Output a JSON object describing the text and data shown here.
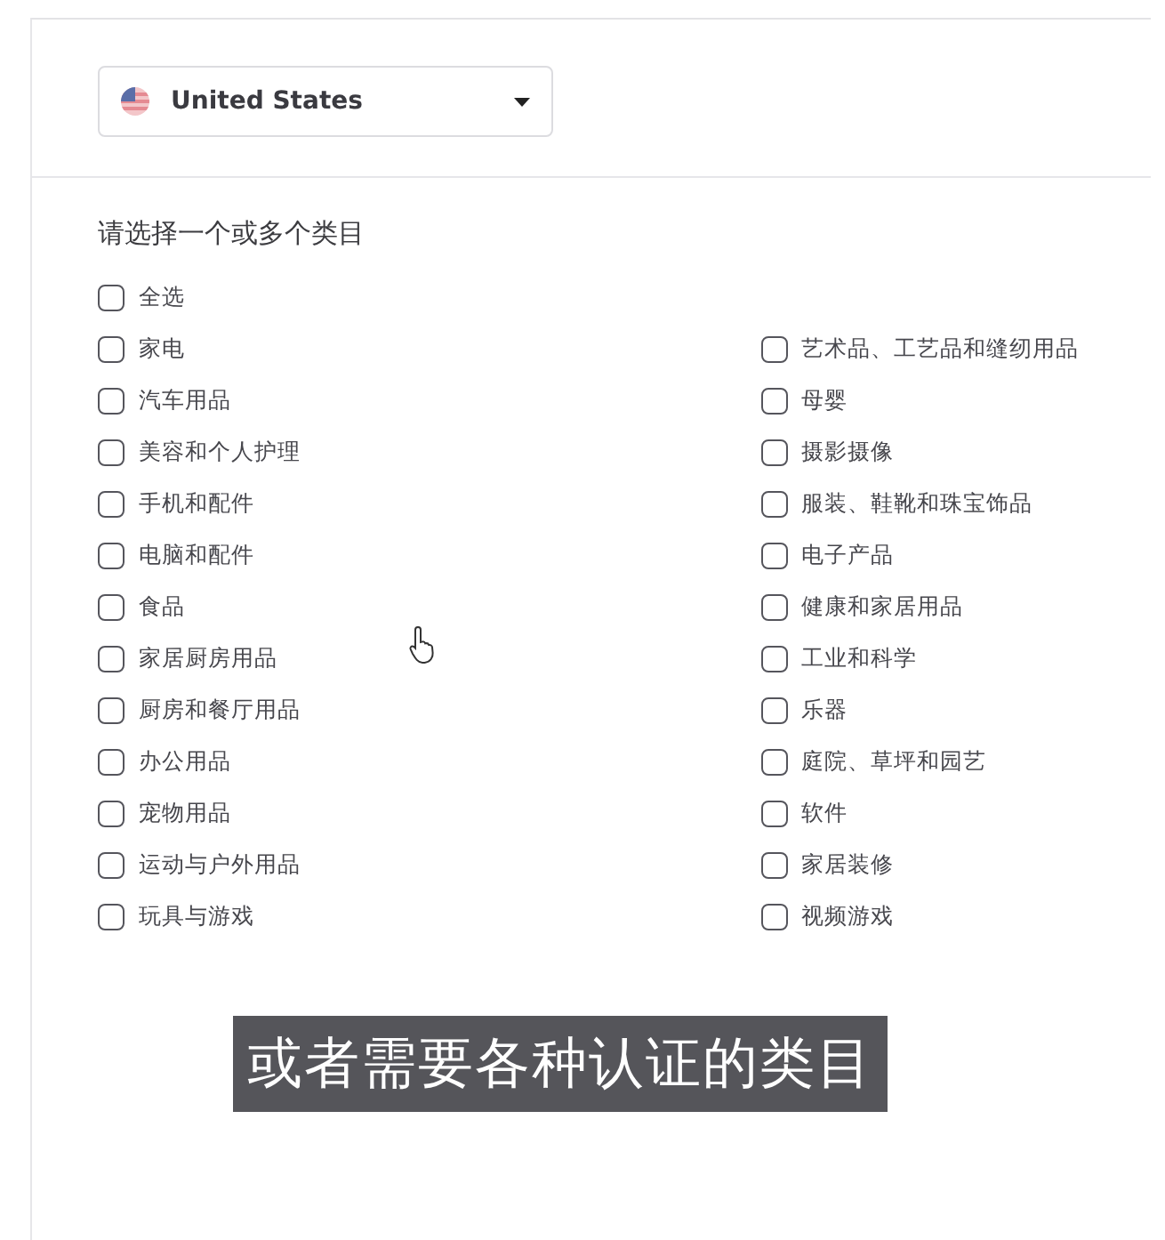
{
  "country_select": {
    "value": "United States"
  },
  "heading": "请选择一个或多个类目",
  "select_all": {
    "label": "全选",
    "checked": false
  },
  "categories_left": [
    {
      "label": "家电",
      "checked": false
    },
    {
      "label": "汽车用品",
      "checked": false
    },
    {
      "label": "美容和个人护理",
      "checked": false
    },
    {
      "label": "手机和配件",
      "checked": false
    },
    {
      "label": "电脑和配件",
      "checked": false
    },
    {
      "label": "食品",
      "checked": false
    },
    {
      "label": "家居厨房用品",
      "checked": false
    },
    {
      "label": "厨房和餐厅用品",
      "checked": false
    },
    {
      "label": "办公用品",
      "checked": false
    },
    {
      "label": "宠物用品",
      "checked": false
    },
    {
      "label": "运动与户外用品",
      "checked": false
    },
    {
      "label": "玩具与游戏",
      "checked": false
    }
  ],
  "categories_right": [
    {
      "label": "艺术品、工艺品和缝纫用品",
      "checked": false
    },
    {
      "label": "母婴",
      "checked": false
    },
    {
      "label": "摄影摄像",
      "checked": false
    },
    {
      "label": "服装、鞋靴和珠宝饰品",
      "checked": false
    },
    {
      "label": "电子产品",
      "checked": false
    },
    {
      "label": "健康和家居用品",
      "checked": false
    },
    {
      "label": "工业和科学",
      "checked": false
    },
    {
      "label": "乐器",
      "checked": false
    },
    {
      "label": "庭院、草坪和园艺",
      "checked": false
    },
    {
      "label": "软件",
      "checked": false
    },
    {
      "label": "家居装修",
      "checked": false
    },
    {
      "label": "视频游戏",
      "checked": false
    }
  ],
  "subtitle": "或者需要各种认证的类目"
}
